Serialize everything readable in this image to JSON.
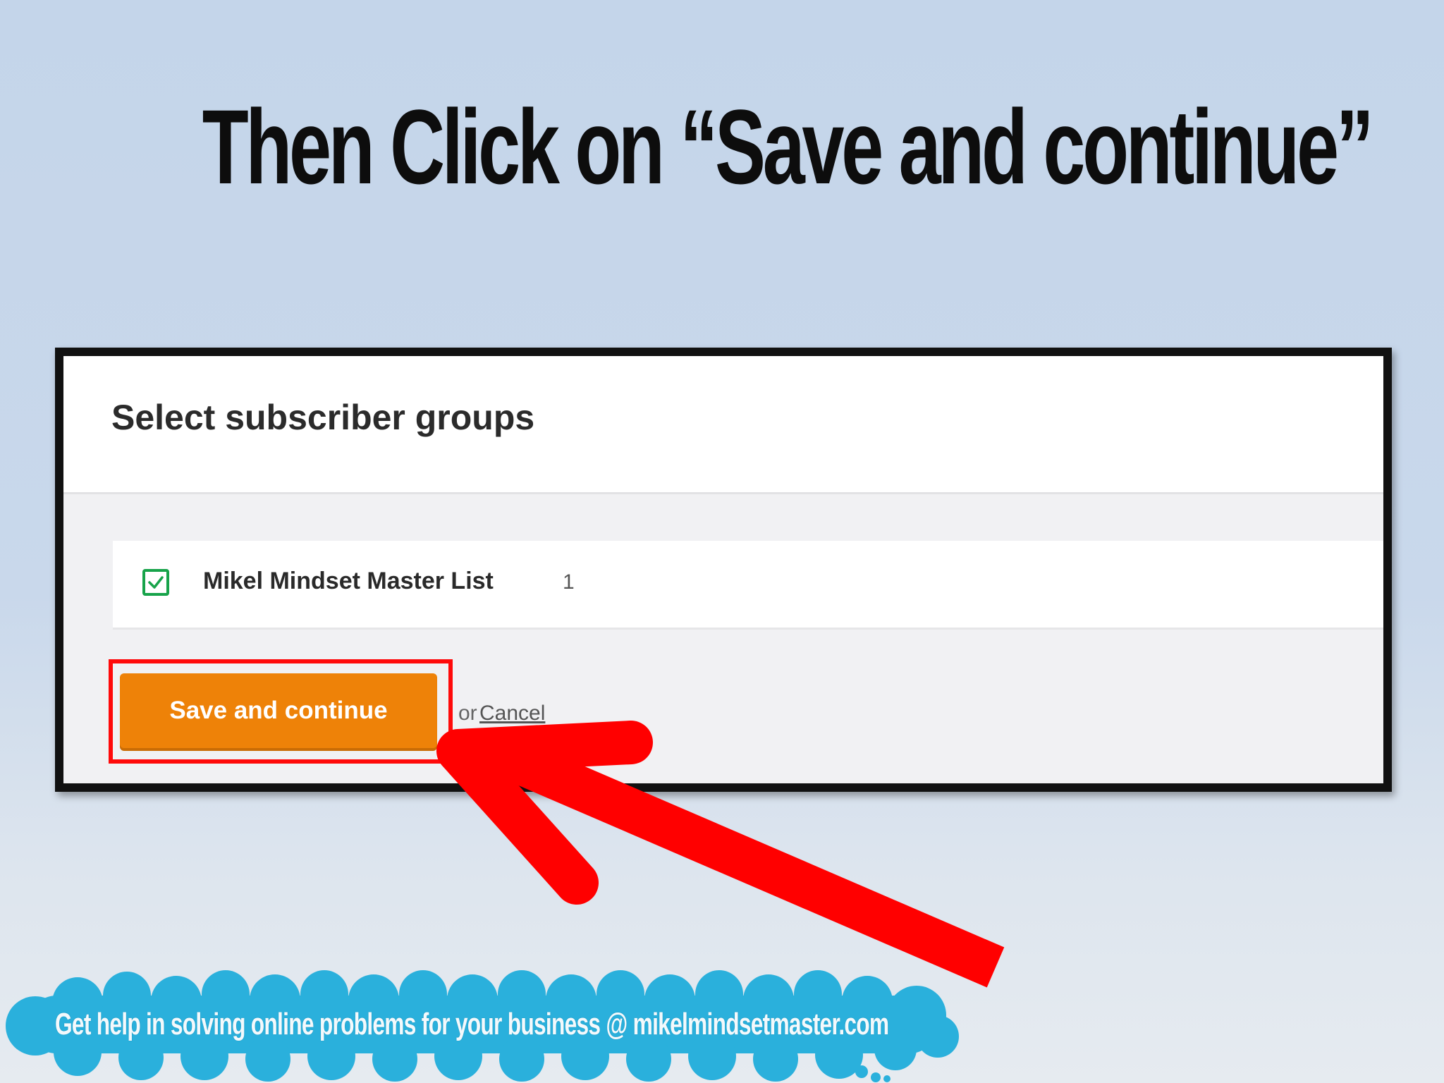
{
  "slide": {
    "title": "Then Click on “Save and continue”"
  },
  "dialog": {
    "title": "Select subscriber groups",
    "groups": [
      {
        "name": "Mikel Mindset Master List",
        "count": "1",
        "checked": true
      }
    ],
    "save_label": "Save and continue",
    "or_label": "or",
    "cancel_label": "Cancel"
  },
  "footer": {
    "banner_text": "Get help in solving online problems for your business @ mikelmindsetmaster.com"
  },
  "colors": {
    "save_button": "#ee8208",
    "highlight": "#ff0a0a",
    "arrow": "#ff0000",
    "checkbox": "#17a34a",
    "cloud": "#2ab0dc"
  },
  "icons": {
    "arrow": "red-arrow-icon",
    "checkbox": "checkmark-icon"
  }
}
